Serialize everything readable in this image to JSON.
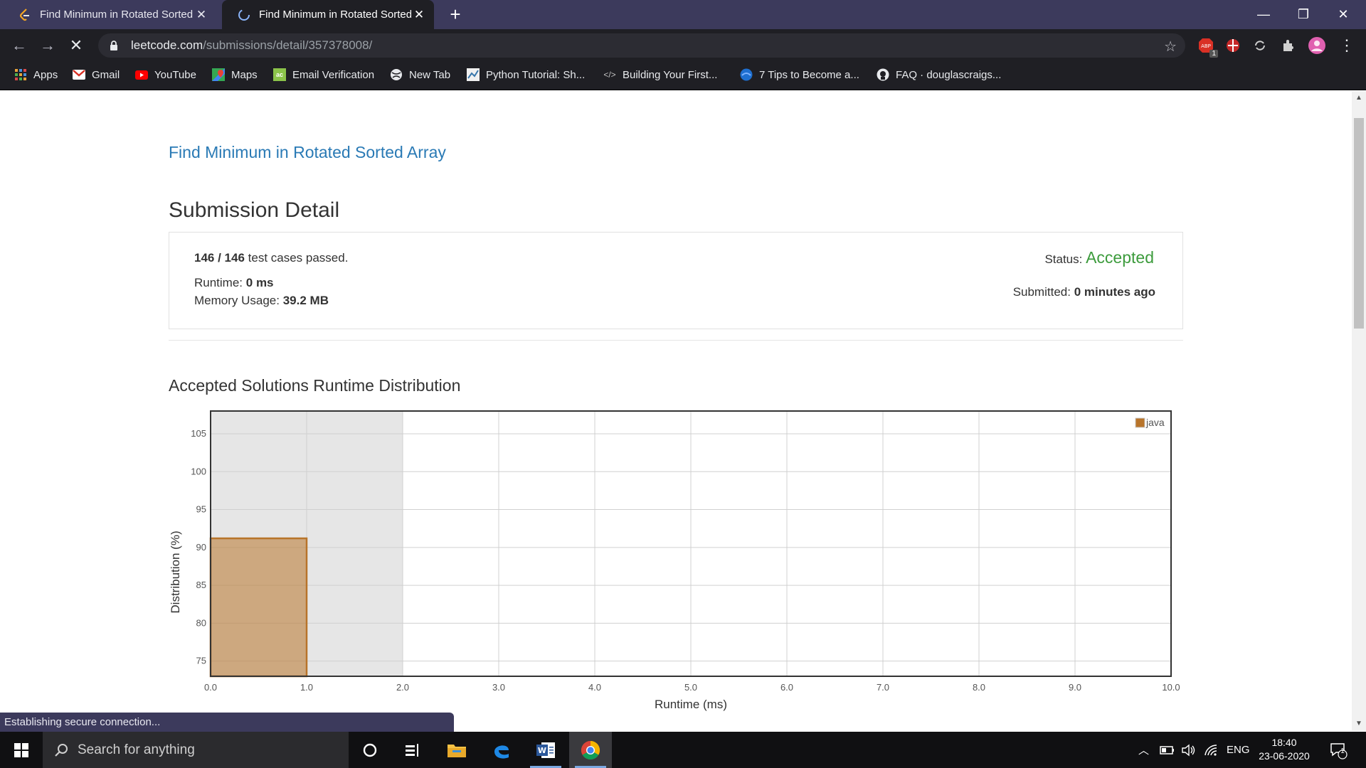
{
  "browser": {
    "tabs": [
      {
        "title": "Find Minimum in Rotated Sorted Array",
        "active": false
      },
      {
        "title": "Find Minimum in Rotated Sorted Array",
        "active": true
      }
    ],
    "url_host": "leetcode.com",
    "url_path": "/submissions/detail/357378008/",
    "bookmarks": [
      "Apps",
      "Gmail",
      "YouTube",
      "Maps",
      "Email Verification",
      "New Tab",
      "Python Tutorial: Sh...",
      "Building Your First...",
      "7 Tips to Become a...",
      "FAQ · douglascraigs..."
    ],
    "extension_badge": "1",
    "status_bubble": "Establishing secure connection..."
  },
  "page": {
    "problem_title": "Find Minimum in Rotated Sorted Array",
    "heading": "Submission Detail",
    "cases_passed": "146 / 146",
    "cases_suffix": "test cases passed.",
    "runtime_label": "Runtime:",
    "runtime_value": "0 ms",
    "memory_label": "Memory Usage:",
    "memory_value": "39.2 MB",
    "status_label": "Status:",
    "status_value": "Accepted",
    "submitted_label": "Submitted:",
    "submitted_value": "0 minutes ago",
    "distribution_heading": "Accepted Solutions Runtime Distribution"
  },
  "chart_data": {
    "type": "bar",
    "xlabel": "Runtime (ms)",
    "ylabel": "Distribution (%)",
    "xlim": [
      0,
      10
    ],
    "ylim": [
      73,
      108
    ],
    "xticks": [
      "0.0",
      "1.0",
      "2.0",
      "3.0",
      "4.0",
      "5.0",
      "6.0",
      "7.0",
      "8.0",
      "9.0",
      "10.0"
    ],
    "yticks": [
      75,
      80,
      85,
      90,
      95,
      100,
      105
    ],
    "series": [
      {
        "name": "java",
        "color": "#b8742a",
        "bars": [
          {
            "x0": 0,
            "x1": 1,
            "value": 91.2
          }
        ]
      }
    ],
    "highlight_range": [
      0,
      2
    ],
    "legend": "top-right",
    "grid": true
  },
  "taskbar": {
    "search_placeholder": "Search for anything",
    "language": "ENG",
    "time": "18:40",
    "date": "23-06-2020",
    "notification_count": "1"
  }
}
